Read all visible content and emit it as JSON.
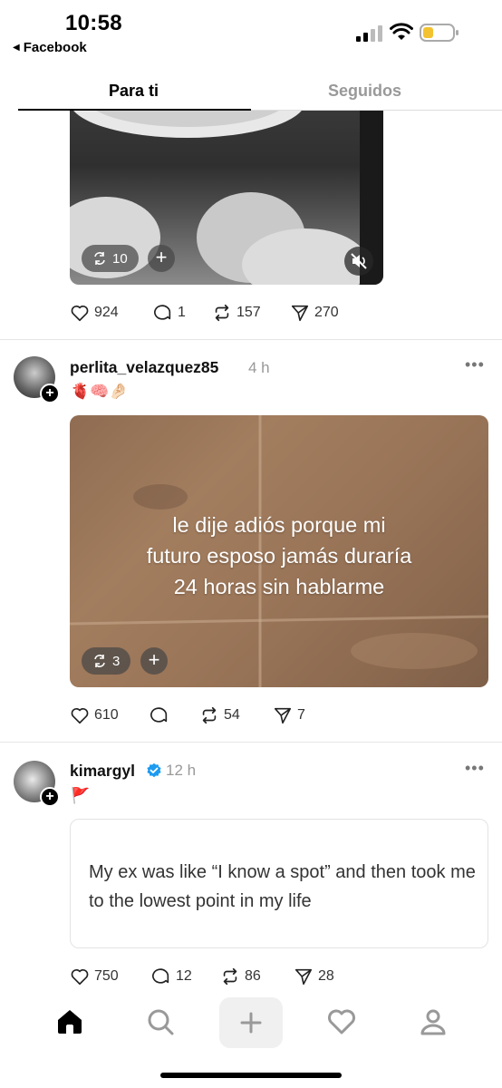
{
  "status_bar": {
    "time": "10:58",
    "back_app": "Facebook",
    "battery_color": "#f2c230"
  },
  "tabs": [
    {
      "label": "Para ti",
      "active": true
    },
    {
      "label": "Seguidos",
      "active": false
    }
  ],
  "posts": [
    {
      "media_kind": "video",
      "repost_count": "10",
      "muted": true,
      "actions": {
        "likes": "924",
        "comments": "1",
        "reposts": "157",
        "shares": "270"
      }
    },
    {
      "username": "perlita_velazquez85",
      "time": "4 h",
      "caption_emojis": "🫀🧠🤌🏻",
      "media_text": [
        "le dije adiós porque mi",
        "futuro esposo jamás duraría",
        "24 horas sin hablarme"
      ],
      "repost_count": "3",
      "actions": {
        "likes": "610",
        "comments": "",
        "reposts": "54",
        "shares": "7"
      }
    },
    {
      "username": "kimargyl",
      "verified": true,
      "time": "12 h",
      "caption_emojis": "🚩",
      "quote_text": "My ex was like “I know a spot” and then took me to the lowest point in my life",
      "actions": {
        "likes": "750",
        "comments": "12",
        "reposts": "86",
        "shares": "28"
      }
    }
  ],
  "bottom_nav": [
    "home-icon",
    "search-icon",
    "create-icon",
    "activity-heart-icon",
    "profile-icon"
  ],
  "colors": {
    "verified": "#1d9bf0",
    "muted_text": "#999999"
  }
}
